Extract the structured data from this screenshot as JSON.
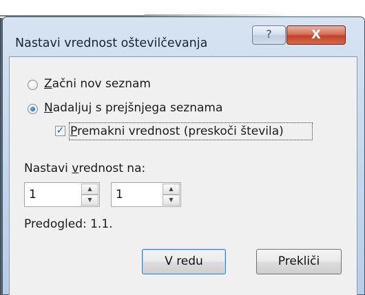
{
  "window": {
    "title": "Nastavi vrednost oštevilčevanja",
    "help_glyph": "?",
    "close_glyph": "X"
  },
  "options": {
    "start_new": {
      "label": "Začni nov seznam",
      "accel": "Z",
      "rest": "ačni nov seznam",
      "selected": false
    },
    "continue_prev": {
      "label": "Nadaljuj s prejšnjega seznama",
      "accel": "N",
      "rest": "adaljuj s prejšnjega seznama",
      "selected": true
    },
    "advance_value": {
      "label": "Premakni vrednost (preskoči števila)",
      "accel": "P",
      "rest": "remakni vrednost (preskoči števila)",
      "checked": true,
      "check_glyph": "✓"
    }
  },
  "set_value": {
    "label_pre": "Nastavi ",
    "label_accel": "v",
    "label_post": "rednost na:",
    "label": "Nastavi vrednost na:",
    "level1": "1",
    "level2": "1",
    "up_glyph": "▲",
    "down_glyph": "▼"
  },
  "preview": {
    "text": "Predogled: 1.1."
  },
  "buttons": {
    "ok": {
      "label": "V redu"
    },
    "cancel": {
      "label": "Prekliči"
    }
  },
  "colors": {
    "frame": "#c7d9ee",
    "client": "#f0f0f0",
    "close_button": "#c44128",
    "default_button_border": "#3c7fb1"
  }
}
